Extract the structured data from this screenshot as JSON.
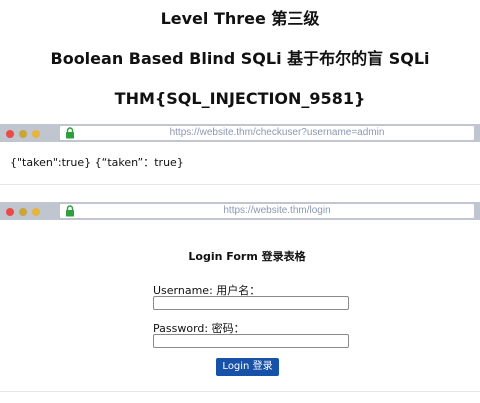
{
  "headings": {
    "level": "Level Three  第三级",
    "topic": "Boolean Based Blind SQLi  基于布尔的盲 SQLi",
    "flag": "THM{SQL_INJECTION_9581}"
  },
  "response_browser": {
    "url": "https://website.thm/checkuser?username=admin",
    "response_text": "{\"taken\":true}  {“taken”：true}"
  },
  "login_browser": {
    "url": "https://website.thm/login",
    "form_title": "Login Form  登录表格",
    "username_label": "Username:  用户名：",
    "username_value": "",
    "password_label": "Password:  密码：",
    "password_value": "",
    "button_label": "Login  登录"
  },
  "colors": {
    "browser_bar": "#bfc6cf",
    "dot_red": "#ec4a46",
    "dot_yellow": "#c9a53a",
    "dot_green": "#e6b53b",
    "lock": "#2e9e3e",
    "url_text": "#8a97b3",
    "button": "#1752a8"
  },
  "icons": {
    "lock": "lock-icon",
    "window_close": "close-dot-icon",
    "window_minimize": "minimize-dot-icon",
    "window_maximize": "maximize-dot-icon"
  }
}
